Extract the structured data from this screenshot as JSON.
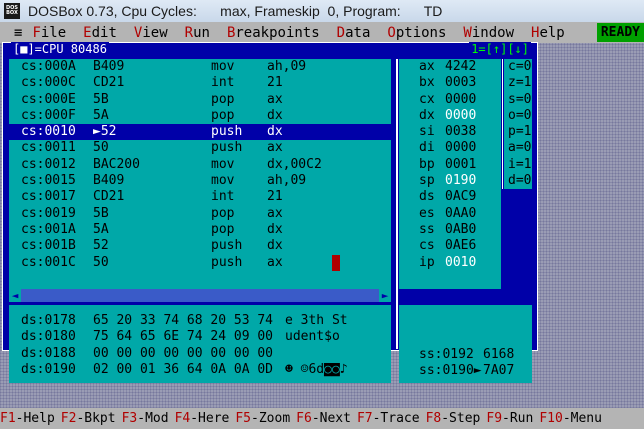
{
  "window": {
    "title": "DOSBox 0.73, Cpu Cycles:      max, Frameskip  0, Program:      TD",
    "icon": "DOS BOX"
  },
  "menu": {
    "system": "≡",
    "items": [
      {
        "hot": "F",
        "rest": "ile"
      },
      {
        "hot": "E",
        "rest": "dit"
      },
      {
        "hot": "V",
        "rest": "iew"
      },
      {
        "hot": "R",
        "rest": "un"
      },
      {
        "hot": "B",
        "rest": "reakpoints"
      },
      {
        "hot": "D",
        "rest": "ata"
      },
      {
        "hot": "O",
        "rest": "ptions"
      },
      {
        "hot": "W",
        "rest": "indow"
      },
      {
        "hot": "H",
        "rest": "elp"
      }
    ],
    "status": "READY"
  },
  "cpu_window": {
    "title_left": "[■]=CPU 80486",
    "title_right": "1=[↑][↓]",
    "code_lines": [
      {
        "addr": "cs:000A",
        "bytes": "B409",
        "op": "mov",
        "args": "ah,09"
      },
      {
        "addr": "cs:000C",
        "bytes": "CD21",
        "op": "int",
        "args": "21"
      },
      {
        "addr": "cs:000E",
        "bytes": "5B",
        "op": "pop",
        "args": "ax"
      },
      {
        "addr": "cs:000F",
        "bytes": "5A",
        "op": "pop",
        "args": "dx"
      },
      {
        "addr": "cs:0010",
        "bytes": "►52",
        "op": "push",
        "args": "dx"
      },
      {
        "addr": "cs:0011",
        "bytes": "50",
        "op": "push",
        "args": "ax"
      },
      {
        "addr": "cs:0012",
        "bytes": "BAC200",
        "op": "mov",
        "args": "dx,00C2"
      },
      {
        "addr": "cs:0015",
        "bytes": "B409",
        "op": "mov",
        "args": "ah,09"
      },
      {
        "addr": "cs:0017",
        "bytes": "CD21",
        "op": "int",
        "args": "21"
      },
      {
        "addr": "cs:0019",
        "bytes": "5B",
        "op": "pop",
        "args": "ax"
      },
      {
        "addr": "cs:001A",
        "bytes": "5A",
        "op": "pop",
        "args": "dx"
      },
      {
        "addr": "cs:001B",
        "bytes": "52",
        "op": "push",
        "args": "dx"
      },
      {
        "addr": "cs:001C",
        "bytes": "50",
        "op": "push",
        "args": "ax"
      }
    ],
    "registers": [
      {
        "name": "ax",
        "value": "4242"
      },
      {
        "name": "bx",
        "value": "0003"
      },
      {
        "name": "cx",
        "value": "0000"
      },
      {
        "name": "dx",
        "value": "0000"
      },
      {
        "name": "si",
        "value": "0038"
      },
      {
        "name": "di",
        "value": "0000"
      },
      {
        "name": "bp",
        "value": "0001"
      },
      {
        "name": "sp",
        "value": "0190"
      },
      {
        "name": "ds",
        "value": "0AC9"
      },
      {
        "name": "es",
        "value": "0AA0"
      },
      {
        "name": "ss",
        "value": "0AB0"
      },
      {
        "name": "cs",
        "value": "0AE6"
      },
      {
        "name": "ip",
        "value": "0010"
      }
    ],
    "flags": [
      "c=0",
      "z=1",
      "s=0",
      "o=0",
      "p=1",
      "a=0",
      "i=1",
      "d=0"
    ],
    "dump_lines": [
      {
        "addr": "ds:0178",
        "bytes": "65 20 33 74 68 20 53 74",
        "ascii": "e 3th St"
      },
      {
        "addr": "ds:0180",
        "bytes": "75 64 65 6E 74 24 09 00",
        "ascii": "udent$o"
      },
      {
        "addr": "ds:0188",
        "bytes": "00 00 00 00 00 00 00 00",
        "ascii": ""
      },
      {
        "addr": "ds:0190",
        "bytes": "02 00 01 36 64 0A 0A 0D",
        "ascii": "☻ ☺6d◙◙♪"
      }
    ],
    "stack_lines": [
      {
        "addr": "ss:0192",
        "value": "6168"
      },
      {
        "addr": "ss:0190►",
        "value": "7A07"
      }
    ]
  },
  "function_keys": [
    {
      "key": "F1",
      "label": "-Help"
    },
    {
      "key": "F2",
      "label": "-Bkpt"
    },
    {
      "key": "F3",
      "label": "-Mod"
    },
    {
      "key": "F4",
      "label": "-Here"
    },
    {
      "key": "F5",
      "label": "-Zoom"
    },
    {
      "key": "F6",
      "label": "-Next"
    },
    {
      "key": "F7",
      "label": "-Trace"
    },
    {
      "key": "F8",
      "label": "-Step"
    },
    {
      "key": "F9",
      "label": "-Run"
    },
    {
      "key": "F10",
      "label": "-Menu"
    }
  ],
  "colors": {
    "accent_red": "#b00000",
    "panel_cyan": "#00a8a8",
    "frame_blue": "#0000a8",
    "ready_green": "#00a000"
  }
}
